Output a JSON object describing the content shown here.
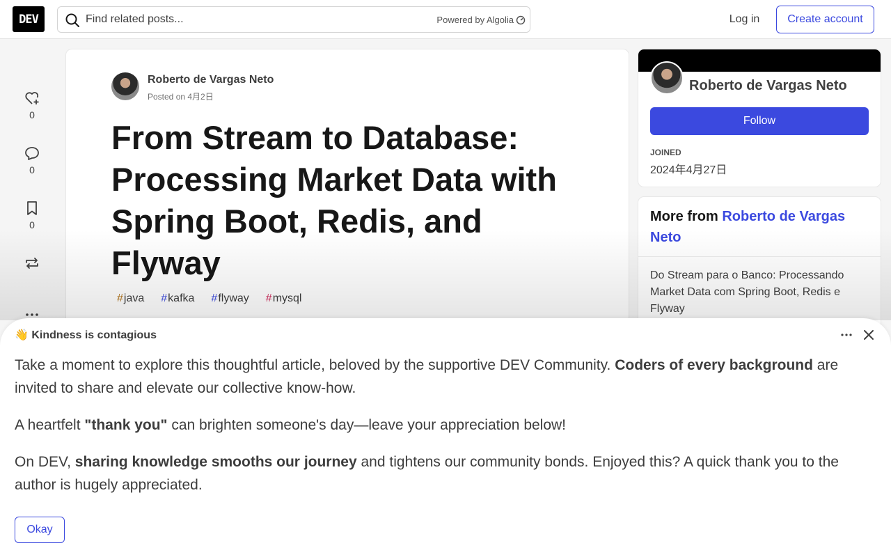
{
  "header": {
    "logo_text": "DEV",
    "search_placeholder": "Find related posts...",
    "powered_by": "Powered by Algolia",
    "login_label": "Log in",
    "create_account_label": "Create account"
  },
  "reactions": {
    "likes": "0",
    "comments": "0",
    "bookmarks": "0"
  },
  "article": {
    "author": "Roberto de Vargas Neto",
    "posted": "Posted on 4月2日",
    "title": "From Stream to Database: Processing Market Data with Spring Boot, Redis, and Flyway",
    "tags": [
      {
        "name": "java",
        "color": "#b07219"
      },
      {
        "name": "kafka",
        "color": "#3b49df"
      },
      {
        "name": "flyway",
        "color": "#3b49df"
      },
      {
        "name": "mysql",
        "color": "#cf2b5c"
      }
    ]
  },
  "sidebar": {
    "author_name": "Roberto de Vargas Neto",
    "follow_label": "Follow",
    "joined_label": "JOINED",
    "joined_value": "2024年4月27日",
    "more_from_prefix": "More from",
    "more_from_author": "Roberto de Vargas Neto",
    "more_post": "Do Stream para o Banco: Processando Market Data com Spring Boot, Redis e Flyway"
  },
  "modal": {
    "emoji": "👋",
    "title": "Kindness is contagious",
    "p1_a": "Take a moment to explore this thoughtful article, beloved by the supportive DEV Community. ",
    "p1_b": "Coders of every background",
    "p1_c": " are invited to share and elevate our collective know-how.",
    "p2_a": "A heartfelt ",
    "p2_b": "\"thank you\"",
    "p2_c": " can brighten someone's day—leave your appreciation below!",
    "p3_a": "On DEV, ",
    "p3_b": "sharing knowledge smooths our journey",
    "p3_c": " and tightens our community bonds. Enjoyed this? A quick thank you to the author is hugely appreciated.",
    "okay_label": "Okay"
  },
  "colors": {
    "accent": "#3b49df"
  }
}
